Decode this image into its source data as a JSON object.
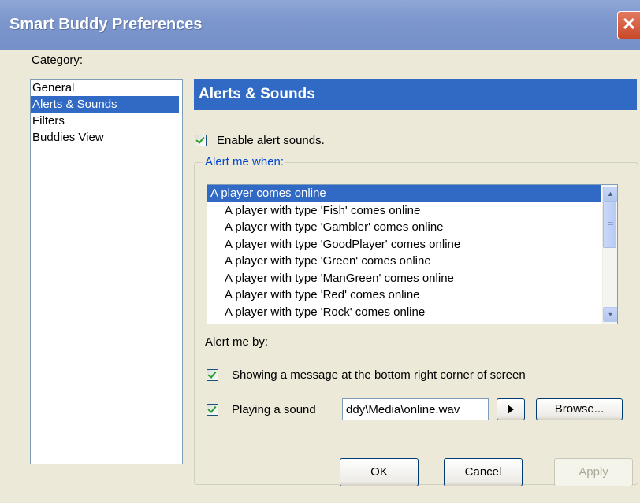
{
  "window": {
    "title": "Smart Buddy Preferences",
    "close_glyph": "✕"
  },
  "category": {
    "label": "Category:",
    "items": [
      "General",
      "Alerts & Sounds",
      "Filters",
      "Buddies View"
    ],
    "selected": "Alerts & Sounds"
  },
  "panel": {
    "title": "Alerts & Sounds"
  },
  "enable_sounds": {
    "label": "Enable alert sounds.",
    "checked": true
  },
  "alert_when": {
    "legend": "Alert me when:",
    "items": [
      "A player comes online",
      "A player with type 'Fish'  comes online",
      "A player with type 'Gambler'  comes online",
      "A player with type 'GoodPlayer'  comes online",
      "A player with type 'Green'  comes online",
      "A player with type 'ManGreen'  comes online",
      "A player with type 'Red'  comes online",
      "A player with type 'Rock'  comes online"
    ],
    "selected": "A player comes online"
  },
  "alert_by": {
    "label": "Alert me by:",
    "show_message": {
      "label": "Showing a message at the bottom right corner of screen",
      "checked": true
    },
    "play_sound": {
      "label": "Playing a sound",
      "checked": true
    },
    "sound_path": "ddy\\Media\\online.wav",
    "browse_label": "Browse..."
  },
  "buttons": {
    "ok": "OK",
    "cancel": "Cancel",
    "apply": "Apply"
  },
  "icons": {
    "scroll_up": "chevron-up-icon",
    "scroll_down": "chevron-down-icon",
    "play": "play-icon",
    "close": "close-icon"
  }
}
